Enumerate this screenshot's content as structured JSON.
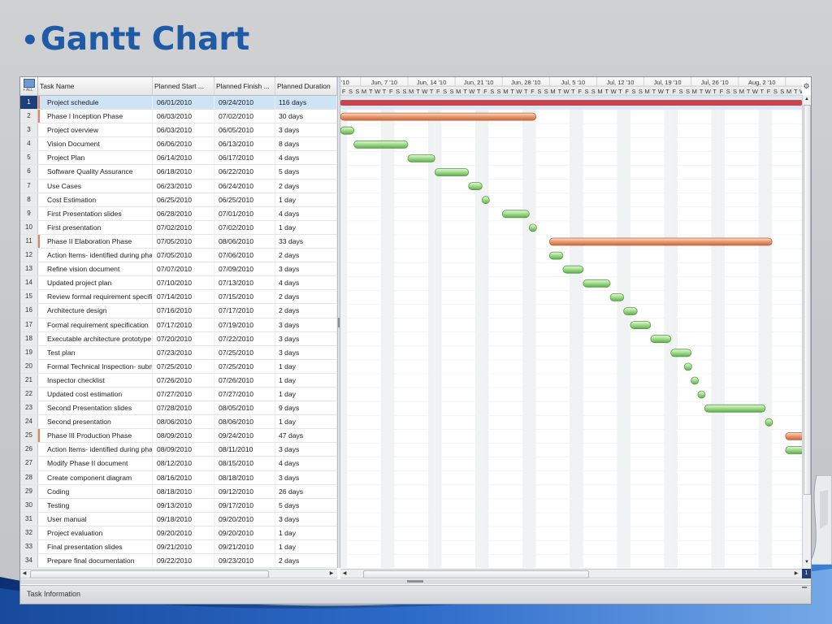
{
  "slide": {
    "bullet": "•",
    "title": "Gantt Chart"
  },
  "grid": {
    "corner_text": "+ ALL",
    "columns": [
      "Task Name",
      "Planned Start ...",
      "Planned Finish ...",
      "Planned Duration"
    ],
    "selected_row": 1
  },
  "chart_data": {
    "type": "gantt",
    "timeline": {
      "start_date": "2010-06-05",
      "day_letters": [
        "S",
        "S",
        "M",
        "T",
        "W",
        "T",
        "F"
      ],
      "first_day_letter": "F",
      "week_labels": [
        "'10",
        "Jun, 7 '10",
        "Jun, 14 '10",
        "Jun, 21 '10",
        "Jun, 28 '10",
        "Jul, 5 '10",
        "Jul, 12 '10",
        "Jul, 19 '10",
        "Jul, 26 '10",
        "Aug, 2 '10",
        "Au"
      ],
      "bar_colors": {
        "summary": "#e6956a",
        "task": "#8fd07b",
        "selected": "#c9444a"
      }
    },
    "tasks": [
      {
        "id": "1",
        "name": "Project schedule",
        "start": "06/01/2010",
        "finish": "09/24/2010",
        "duration": "116 days",
        "summary": true
      },
      {
        "id": "2",
        "name": "Phase I Inception Phase",
        "start": "06/03/2010",
        "finish": "07/02/2010",
        "duration": "30 days",
        "summary": true
      },
      {
        "id": "3",
        "name": "Project overview",
        "start": "06/03/2010",
        "finish": "06/05/2010",
        "duration": "3 days",
        "summary": false
      },
      {
        "id": "4",
        "name": "Vision Document",
        "start": "06/06/2010",
        "finish": "06/13/2010",
        "duration": "8 days",
        "summary": false
      },
      {
        "id": "5",
        "name": "Project Plan",
        "start": "06/14/2010",
        "finish": "06/17/2010",
        "duration": "4 days",
        "summary": false
      },
      {
        "id": "6",
        "name": "Software Quality Assurance",
        "start": "06/18/2010",
        "finish": "06/22/2010",
        "duration": "5 days",
        "summary": false
      },
      {
        "id": "7",
        "name": "Use Cases",
        "start": "06/23/2010",
        "finish": "06/24/2010",
        "duration": "2 days",
        "summary": false
      },
      {
        "id": "8",
        "name": "Cost Estimation",
        "start": "06/25/2010",
        "finish": "06/25/2010",
        "duration": "1 day",
        "summary": false
      },
      {
        "id": "9",
        "name": "First Presentation slides",
        "start": "06/28/2010",
        "finish": "07/01/2010",
        "duration": "4 days",
        "summary": false
      },
      {
        "id": "10",
        "name": "First presentation",
        "start": "07/02/2010",
        "finish": "07/02/2010",
        "duration": "1 day",
        "summary": false
      },
      {
        "id": "11",
        "name": "Phase II Elaboration Phase",
        "start": "07/05/2010",
        "finish": "08/06/2010",
        "duration": "33 days",
        "summary": true
      },
      {
        "id": "12",
        "name": "Action Items- identified during phase I",
        "start": "07/05/2010",
        "finish": "07/06/2010",
        "duration": "2 days",
        "summary": false
      },
      {
        "id": "13",
        "name": "Refine vision document",
        "start": "07/07/2010",
        "finish": "07/09/2010",
        "duration": "3 days",
        "summary": false
      },
      {
        "id": "14",
        "name": "Updated project plan",
        "start": "07/10/2010",
        "finish": "07/13/2010",
        "duration": "4 days",
        "summary": false
      },
      {
        "id": "15",
        "name": "Review formal requirement specification",
        "start": "07/14/2010",
        "finish": "07/15/2010",
        "duration": "2 days",
        "summary": false
      },
      {
        "id": "16",
        "name": "Architecture design",
        "start": "07/16/2010",
        "finish": "07/17/2010",
        "duration": "2 days",
        "summary": false
      },
      {
        "id": "17",
        "name": "Formal requirement specification",
        "start": "07/17/2010",
        "finish": "07/19/2010",
        "duration": "3 days",
        "summary": false
      },
      {
        "id": "18",
        "name": "Executable architecture prototype",
        "start": "07/20/2010",
        "finish": "07/22/2010",
        "duration": "3 days",
        "summary": false
      },
      {
        "id": "19",
        "name": "Test plan",
        "start": "07/23/2010",
        "finish": "07/25/2010",
        "duration": "3 days",
        "summary": false
      },
      {
        "id": "20",
        "name": "Formal Technical Inspection- submitted",
        "start": "07/25/2010",
        "finish": "07/25/2010",
        "duration": "1 day",
        "summary": false
      },
      {
        "id": "21",
        "name": "Inspector checklist",
        "start": "07/26/2010",
        "finish": "07/26/2010",
        "duration": "1 day",
        "summary": false
      },
      {
        "id": "22",
        "name": "Updated cost estimation",
        "start": "07/27/2010",
        "finish": "07/27/2010",
        "duration": "1 day",
        "summary": false
      },
      {
        "id": "23",
        "name": "Second Presentation slides",
        "start": "07/28/2010",
        "finish": "08/05/2010",
        "duration": "9 days",
        "summary": false
      },
      {
        "id": "24",
        "name": "Second presentation",
        "start": "08/06/2010",
        "finish": "08/06/2010",
        "duration": "1 day",
        "summary": false
      },
      {
        "id": "25",
        "name": "Phase III Production Phase",
        "start": "08/09/2010",
        "finish": "09/24/2010",
        "duration": "47 days",
        "summary": true
      },
      {
        "id": "26",
        "name": "Action Items- identified during phase II",
        "start": "08/09/2010",
        "finish": "08/11/2010",
        "duration": "3 days",
        "summary": false
      },
      {
        "id": "27",
        "name": "Modify Phase II document",
        "start": "08/12/2010",
        "finish": "08/15/2010",
        "duration": "4 days",
        "summary": false
      },
      {
        "id": "28",
        "name": "Create component diagram",
        "start": "08/16/2010",
        "finish": "08/18/2010",
        "duration": "3 days",
        "summary": false
      },
      {
        "id": "29",
        "name": "Coding",
        "start": "08/18/2010",
        "finish": "09/12/2010",
        "duration": "26 days",
        "summary": false
      },
      {
        "id": "30",
        "name": "Testing",
        "start": "09/13/2010",
        "finish": "09/17/2010",
        "duration": "5 days",
        "summary": false
      },
      {
        "id": "31",
        "name": "User manual",
        "start": "09/18/2010",
        "finish": "09/20/2010",
        "duration": "3 days",
        "summary": false
      },
      {
        "id": "32",
        "name": "Project evaluation",
        "start": "09/20/2010",
        "finish": "09/20/2010",
        "duration": "1 day",
        "summary": false
      },
      {
        "id": "33",
        "name": "Final presentation slides",
        "start": "09/21/2010",
        "finish": "09/21/2010",
        "duration": "1 day",
        "summary": false
      },
      {
        "id": "34",
        "name": "Prepare final documentation",
        "start": "09/22/2010",
        "finish": "09/23/2010",
        "duration": "2 days",
        "summary": false
      }
    ]
  },
  "footer": {
    "task_info_label": "Task Information",
    "page_indicator": "1"
  },
  "icons": {
    "scroll_up": "▲",
    "scroll_down": "▼",
    "scroll_left": "◀",
    "scroll_right": "▶",
    "grip": "⁞",
    "pin": "▔",
    "settings": "⚙"
  }
}
